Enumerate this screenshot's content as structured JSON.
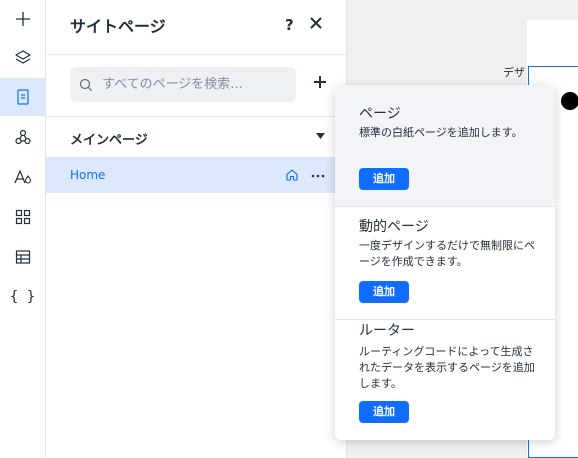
{
  "rail": {
    "items": [
      {
        "icon": "plus-icon"
      },
      {
        "icon": "layers-icon"
      },
      {
        "icon": "pages-icon",
        "active": true
      },
      {
        "icon": "apps-network-icon"
      },
      {
        "icon": "theme-text-icon"
      },
      {
        "icon": "app-grid-icon"
      },
      {
        "icon": "table-icon"
      },
      {
        "icon": "code-braces-icon",
        "glyph": "{ }"
      }
    ]
  },
  "panel": {
    "title": "サイトページ",
    "help_label": "?",
    "search_placeholder": "すべてのページを検索...",
    "section_label": "メインページ",
    "pages": [
      {
        "label": "Home"
      }
    ]
  },
  "canvas": {
    "snippet": "デザ"
  },
  "add_menu": {
    "options": [
      {
        "title": "ページ",
        "description": "標準の白紙ページを追加します。",
        "button": "追加"
      },
      {
        "title": "動的ページ",
        "description": "一度デザインするだけで無制限にページを作成できます。",
        "button": "追加"
      },
      {
        "title": "ルーター",
        "description": "ルーティングコードによって生成されたデータを表示するページを追加します。",
        "button": "追加"
      }
    ]
  },
  "colors": {
    "accent": "#116dff",
    "selected_bg": "#dce8fb",
    "text": "#20303c"
  }
}
